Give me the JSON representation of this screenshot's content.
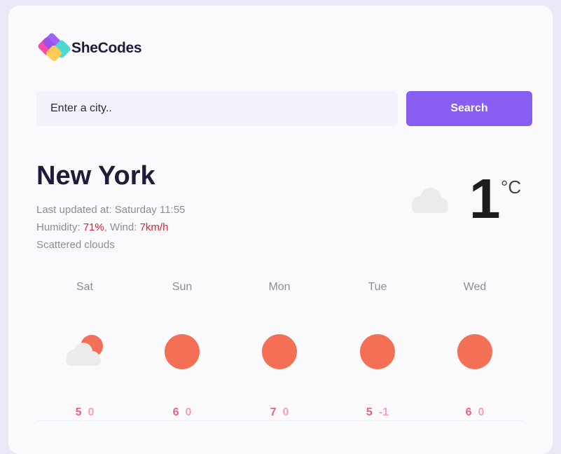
{
  "brand": {
    "name": "SheCodes"
  },
  "search": {
    "placeholder": "Enter a city..",
    "button_label": "Search"
  },
  "current": {
    "city": "New York",
    "updated_label": "Last updated at: ",
    "updated_value": "Saturday 11:55",
    "humidity_label": "Humidity: ",
    "humidity_value": "71%",
    "wind_label": ", Wind: ",
    "wind_value": "7km/h",
    "description": "Scattered clouds",
    "temperature": "1",
    "unit": "°C",
    "icon": "cloud-icon"
  },
  "forecast": [
    {
      "day": "Sat",
      "max": "5",
      "min": "0",
      "icon": "partly-cloudy-icon"
    },
    {
      "day": "Sun",
      "max": "6",
      "min": "0",
      "icon": "sun-icon"
    },
    {
      "day": "Mon",
      "max": "7",
      "min": "0",
      "icon": "sun-icon"
    },
    {
      "day": "Tue",
      "max": "5",
      "min": "-1",
      "icon": "sun-icon"
    },
    {
      "day": "Wed",
      "max": "6",
      "min": "0",
      "icon": "sun-icon"
    }
  ],
  "colors": {
    "accent": "#885df1",
    "highlight": "#e0212f",
    "temp_max": "#f65c7c",
    "temp_min": "#f8a0b6",
    "sun": "#f36f56"
  }
}
